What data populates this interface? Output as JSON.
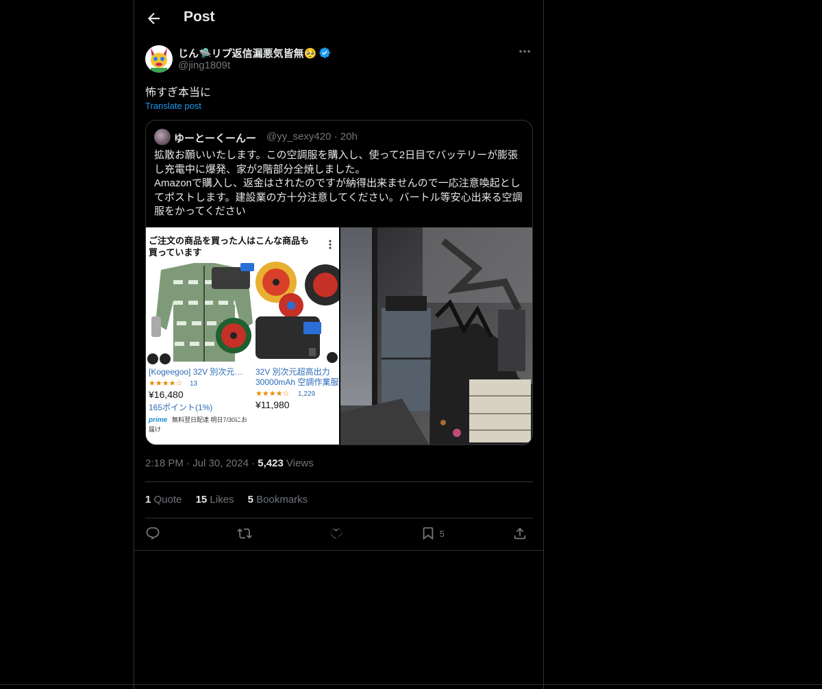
{
  "header": {
    "title": "Post"
  },
  "author": {
    "display_name": "じん🛸リプ返信漏悪気皆無🥺",
    "handle": "@jing1809t"
  },
  "post": {
    "text": "怖すぎ本当に",
    "translate_label": "Translate post"
  },
  "quoted": {
    "name": "ゆーとーくーんー",
    "handle": "@yy_sexy420",
    "separator": "·",
    "time": "20h",
    "text": "拡散お願いいたします。この空調服を購入し、使って2日目でバッテリーが膨張し充電中に爆発、家が2階部分全焼しました。\nAmazonで購入し、返金はされたのですが納得出来ませんので一応注意喚起としてポストします。建設業の方十分注意してください。バートル等安心出来る空調服をかってください",
    "screenshot": {
      "heading_line1": "ご注文の商品を買った人はこんな商品も",
      "heading_line2": "買っています",
      "product1_name": "[Kogeegoo] 32V 別次元…",
      "product1_rating_count": "13",
      "product1_price": "¥16,480",
      "product1_points": "165ポイント(1%)",
      "product1_prime": "prime",
      "product1_delivery": "無料翌日配達 明日7/30にお",
      "product1_delivery2": "届け",
      "product2_name_line1": "32V 別次元超高出力",
      "product2_name_line2": "30000mAh 空調作業服",
      "product2_rating_count": "1,229",
      "product2_price": "¥11,980"
    }
  },
  "meta": {
    "time": "2:18 PM",
    "dot": "·",
    "date": "Jul 30, 2024",
    "views_count": "5,423",
    "views_label": "Views"
  },
  "stats": {
    "quotes_count": "1",
    "quotes_label": "Quote",
    "likes_count": "15",
    "likes_label": "Likes",
    "bookmarks_count": "5",
    "bookmarks_label": "Bookmarks"
  },
  "actions": {
    "bookmark_count": "5"
  },
  "colors": {
    "accent": "#1d9bf0",
    "muted": "#71767b",
    "text": "#e7e9ea",
    "border": "#2f3336"
  }
}
